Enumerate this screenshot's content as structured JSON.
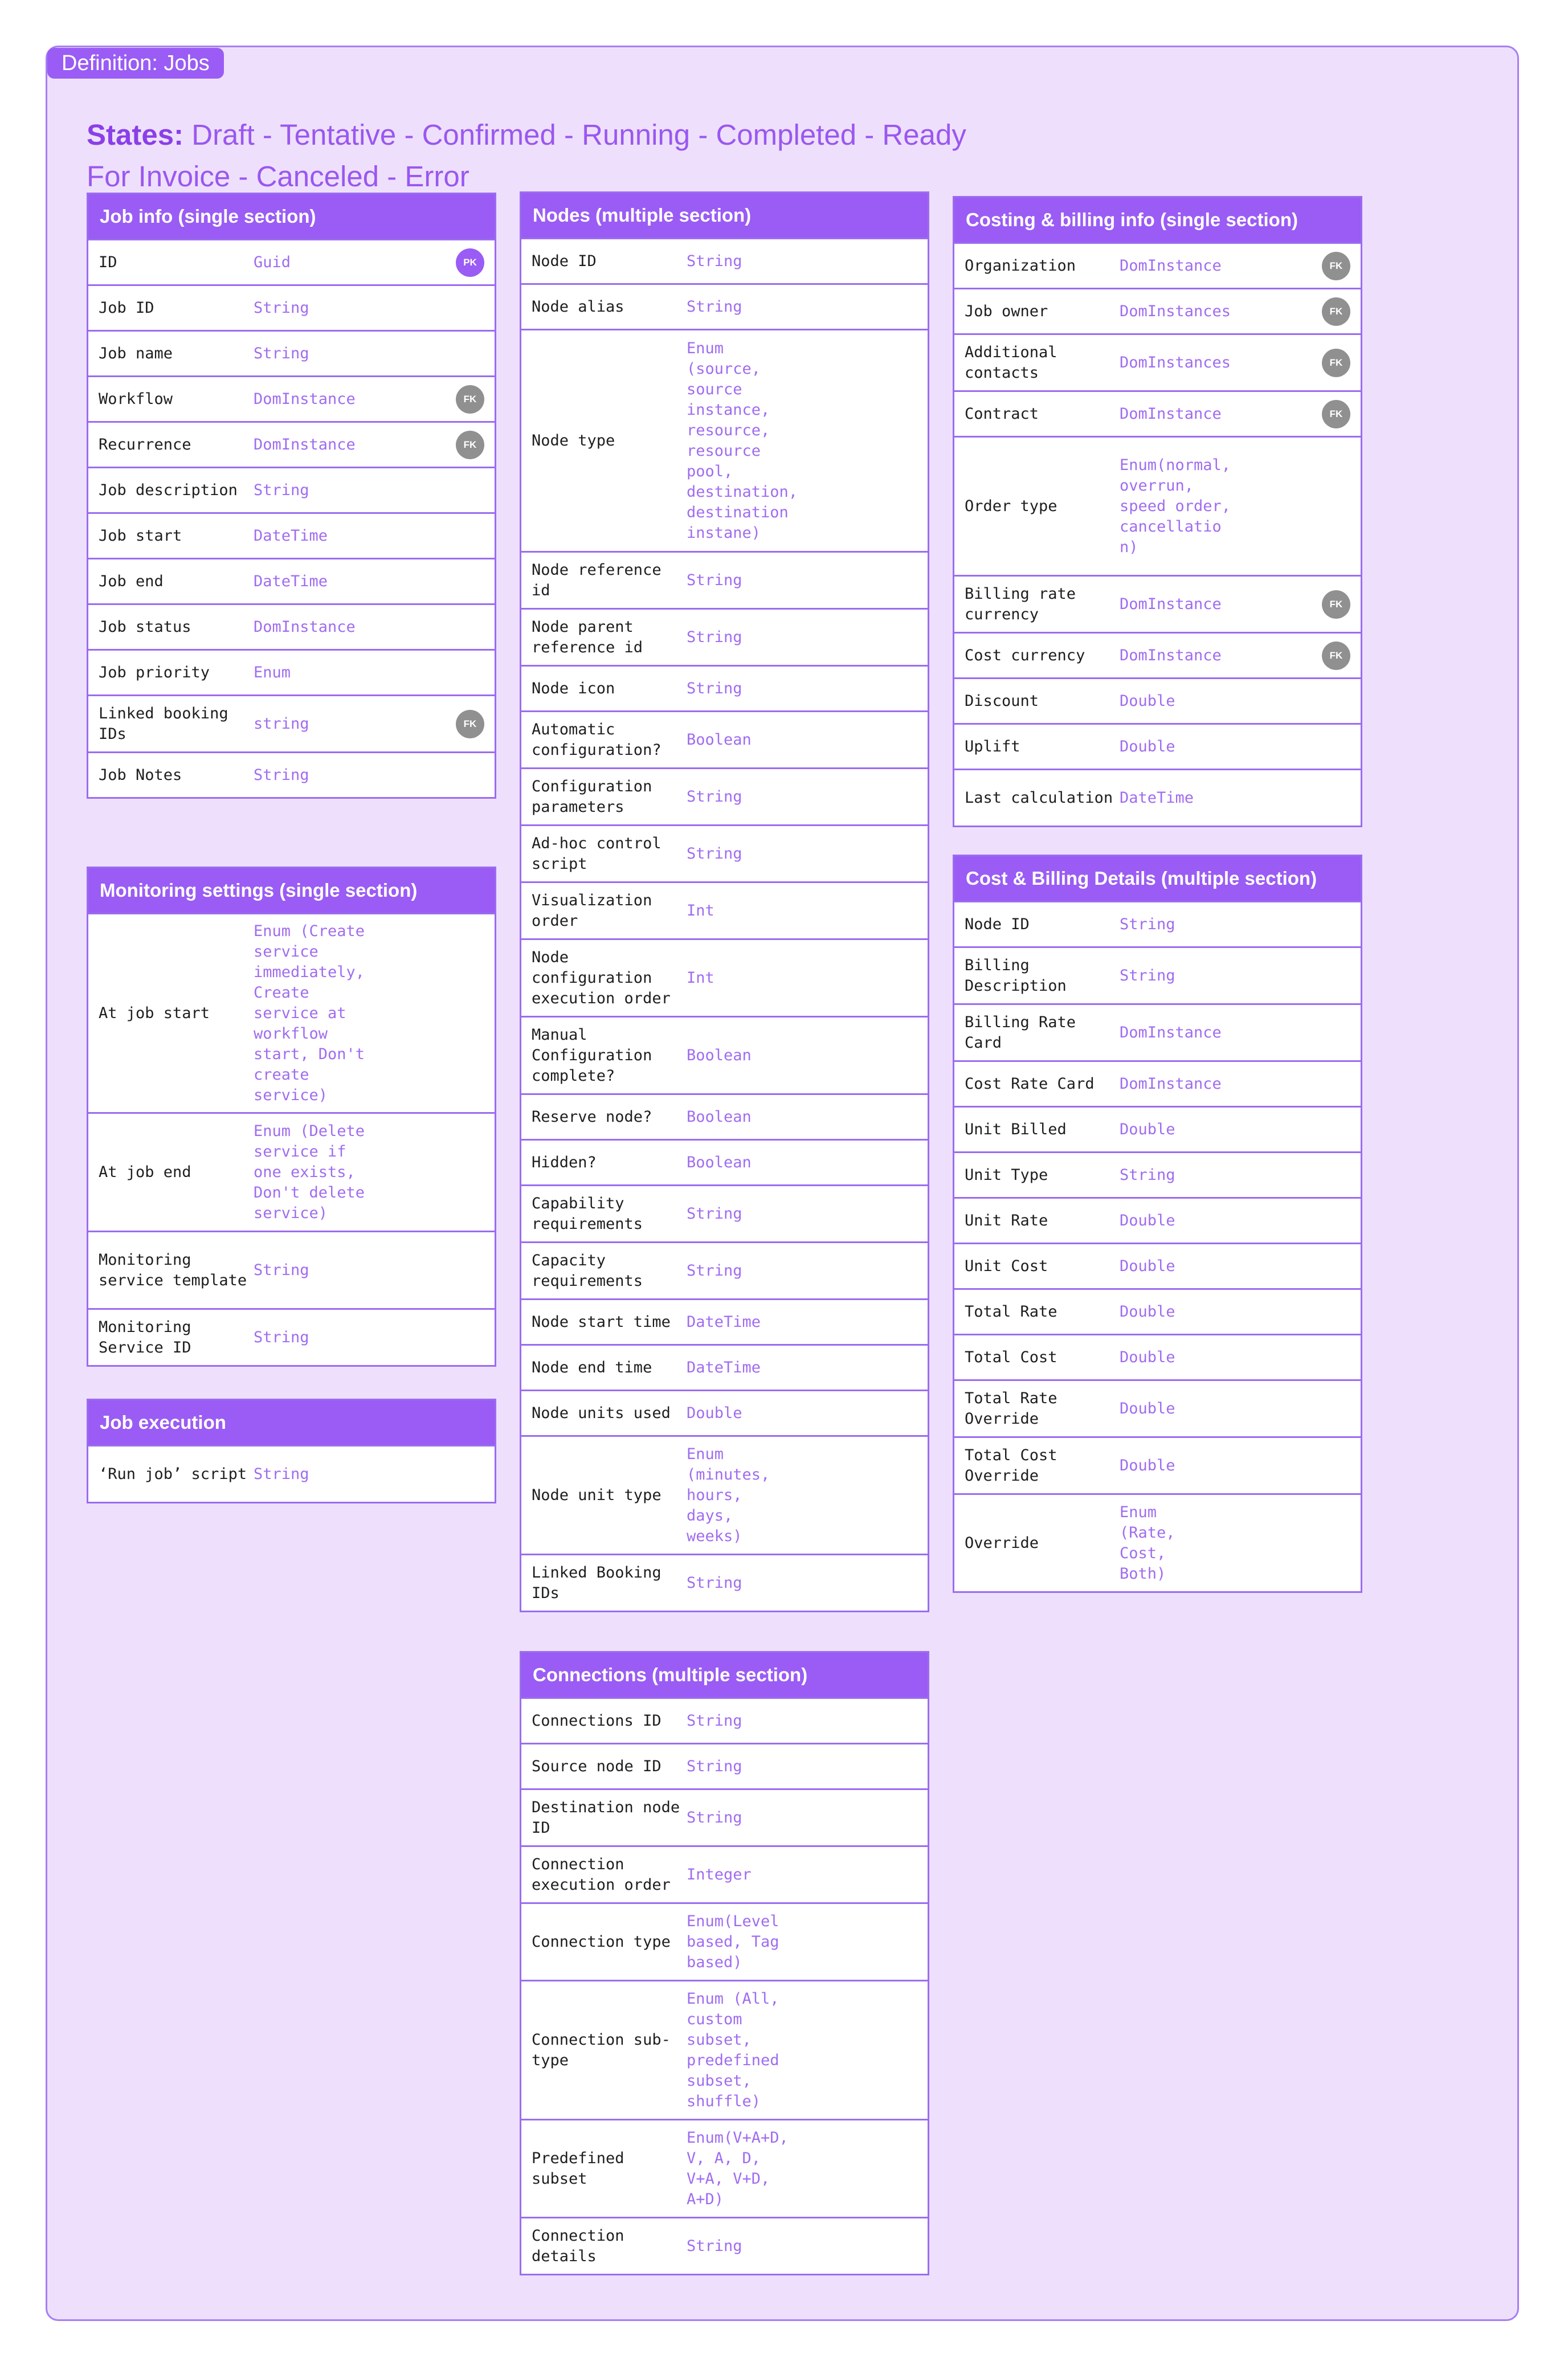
{
  "frame_label": "Definition: Jobs",
  "states": {
    "label": "States:",
    "text": " Draft - Tentative - Confirmed - Running - Completed - Ready For Invoice - Canceled - Error"
  },
  "tables": [
    {
      "id": "job-info",
      "title": "Job info (single section)",
      "rows": [
        {
          "name": "ID",
          "type": "Guid",
          "key": "PK"
        },
        {
          "name": "Job ID",
          "type": "String"
        },
        {
          "name": "Job name",
          "type": "String"
        },
        {
          "name": "Workflow",
          "type": "DomInstance",
          "key": "FK"
        },
        {
          "name": "Recurrence",
          "type": "DomInstance",
          "key": "FK"
        },
        {
          "name": "Job description",
          "type": "String"
        },
        {
          "name": "Job start",
          "type": "DateTime"
        },
        {
          "name": "Job end",
          "type": "DateTime"
        },
        {
          "name": "Job status",
          "type": "DomInstance"
        },
        {
          "name": "Job priority",
          "type": "Enum"
        },
        {
          "name": "Linked booking IDs",
          "type": "string",
          "key": "FK"
        },
        {
          "name": "Job Notes",
          "type": "String"
        }
      ]
    },
    {
      "id": "monitoring-settings",
      "title": "Monitoring settings (single section)",
      "rows": [
        {
          "name": "At job start",
          "type": "Enum (Create\nservice\nimmediately,\nCreate\nservice at\nworkflow\nstart, Don't\ncreate\nservice)"
        },
        {
          "name": "At job end",
          "type": "Enum (Delete\nservice if\none exists,\nDon't delete\nservice)"
        },
        {
          "name": "Monitoring service template",
          "type": "String"
        },
        {
          "name": "Monitoring Service ID",
          "type": "String"
        }
      ]
    },
    {
      "id": "job-execution",
      "title": "Job execution",
      "rows": [
        {
          "name": "‘Run job’ script",
          "type": "String"
        }
      ]
    },
    {
      "id": "nodes",
      "title": "Nodes (multiple section)",
      "rows": [
        {
          "name": "Node ID",
          "type": "String"
        },
        {
          "name": "Node alias",
          "type": "String"
        },
        {
          "name": "Node type",
          "type": "Enum\n(source,\nsource\ninstance,\nresource,\nresource\npool,\ndestination,\ndestination\ninstane)"
        },
        {
          "name": "Node reference id",
          "type": "String"
        },
        {
          "name": "Node parent reference id",
          "type": "String"
        },
        {
          "name": "Node icon",
          "type": "String"
        },
        {
          "name": "Automatic configuration?",
          "type": "Boolean"
        },
        {
          "name": "Configuration parameters",
          "type": "String"
        },
        {
          "name": "Ad-hoc control script",
          "type": "String"
        },
        {
          "name": "Visualization order",
          "type": "Int"
        },
        {
          "name": "Node configuration execution order",
          "type": "Int"
        },
        {
          "name": "Manual Configuration complete?",
          "type": "Boolean"
        },
        {
          "name": "Reserve node?",
          "type": "Boolean"
        },
        {
          "name": "Hidden?",
          "type": "Boolean"
        },
        {
          "name": "Capability requirements",
          "type": "String"
        },
        {
          "name": "Capacity requirements",
          "type": "String"
        },
        {
          "name": "Node start time",
          "type": "DateTime"
        },
        {
          "name": "Node end time",
          "type": "DateTime"
        },
        {
          "name": "Node units used",
          "type": "Double"
        },
        {
          "name": "Node unit type",
          "type": "Enum\n(minutes,\nhours,\ndays,\nweeks)"
        },
        {
          "name": "Linked Booking IDs",
          "type": "String"
        }
      ]
    },
    {
      "id": "connections",
      "title": "Connections (multiple section)",
      "rows": [
        {
          "name": "Connections ID",
          "type": "String"
        },
        {
          "name": "Source node ID",
          "type": "String"
        },
        {
          "name": "Destination node ID",
          "type": "String"
        },
        {
          "name": "Connection execution order",
          "type": "Integer"
        },
        {
          "name": "Connection type",
          "type": "Enum(Level\nbased, Tag\nbased)"
        },
        {
          "name": "Connection sub-type",
          "type": "Enum (All,\ncustom\nsubset,\npredefined\nsubset,\nshuffle)"
        },
        {
          "name": "Predefined subset",
          "type": "Enum(V+A+D,\nV, A, D,\nV+A, V+D,\nA+D)"
        },
        {
          "name": "Connection details",
          "type": "String"
        }
      ]
    },
    {
      "id": "costing-billing",
      "title": "Costing & billing info (single section)",
      "rows": [
        {
          "name": "Organization",
          "type": "DomInstance",
          "key": "FK"
        },
        {
          "name": "Job owner",
          "type": "DomInstances",
          "key": "FK"
        },
        {
          "name": "Additional contacts",
          "type": "DomInstances",
          "key": "FK"
        },
        {
          "name": "Contract",
          "type": "DomInstance",
          "key": "FK"
        },
        {
          "name": "Order type",
          "type": "Enum(normal,\noverrun,\nspeed order,\ncancellatio\nn)"
        },
        {
          "name": "Billing rate currency",
          "type": "DomInstance",
          "key": "FK"
        },
        {
          "name": "Cost currency",
          "type": "DomInstance",
          "key": "FK"
        },
        {
          "name": "Discount",
          "type": "Double"
        },
        {
          "name": "Uplift",
          "type": "Double"
        },
        {
          "name": "Last calculation",
          "type": "DateTime"
        }
      ]
    },
    {
      "id": "cost-billing-details",
      "title": "Cost & Billing Details (multiple section)",
      "rows": [
        {
          "name": "Node ID",
          "type": "String"
        },
        {
          "name": "Billing Description",
          "type": "String"
        },
        {
          "name": "Billing Rate Card",
          "type": "DomInstance"
        },
        {
          "name": "Cost Rate Card",
          "type": "DomInstance"
        },
        {
          "name": "Unit Billed",
          "type": "Double"
        },
        {
          "name": "Unit Type",
          "type": "String"
        },
        {
          "name": "Unit Rate",
          "type": "Double"
        },
        {
          "name": "Unit Cost",
          "type": "Double"
        },
        {
          "name": "Total Rate",
          "type": "Double"
        },
        {
          "name": "Total Cost",
          "type": "Double"
        },
        {
          "name": "Total Rate Override",
          "type": "Double"
        },
        {
          "name": "Total Cost Override",
          "type": "Double"
        },
        {
          "name": "Override",
          "type": "Enum\n(Rate,\nCost,\nBoth)"
        }
      ]
    }
  ]
}
